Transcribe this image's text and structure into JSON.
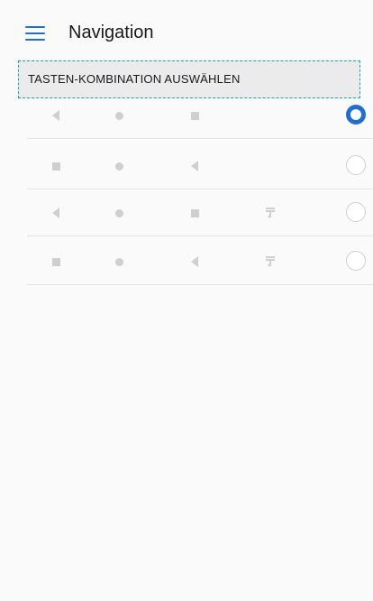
{
  "header": {
    "title": "Navigation",
    "menu_icon": "hamburger-menu-icon"
  },
  "section": {
    "label": "TASTEN-KOMBINATION AUSWÄHLEN"
  },
  "colors": {
    "accent": "#1f6fd1",
    "icon_gray": "#cfcfcf",
    "section_bg": "#ebebeb",
    "highlight_border": "#1aa3b5"
  },
  "options": [
    {
      "keys": [
        "back-icon",
        "home-icon",
        "recents-icon"
      ],
      "selected": true
    },
    {
      "keys": [
        "recents-icon",
        "home-icon",
        "back-icon"
      ],
      "selected": false
    },
    {
      "keys": [
        "back-icon",
        "home-icon",
        "recents-icon",
        "notification-pull-down-icon"
      ],
      "selected": false
    },
    {
      "keys": [
        "recents-icon",
        "home-icon",
        "back-icon",
        "notification-pull-down-icon"
      ],
      "selected": false
    }
  ]
}
